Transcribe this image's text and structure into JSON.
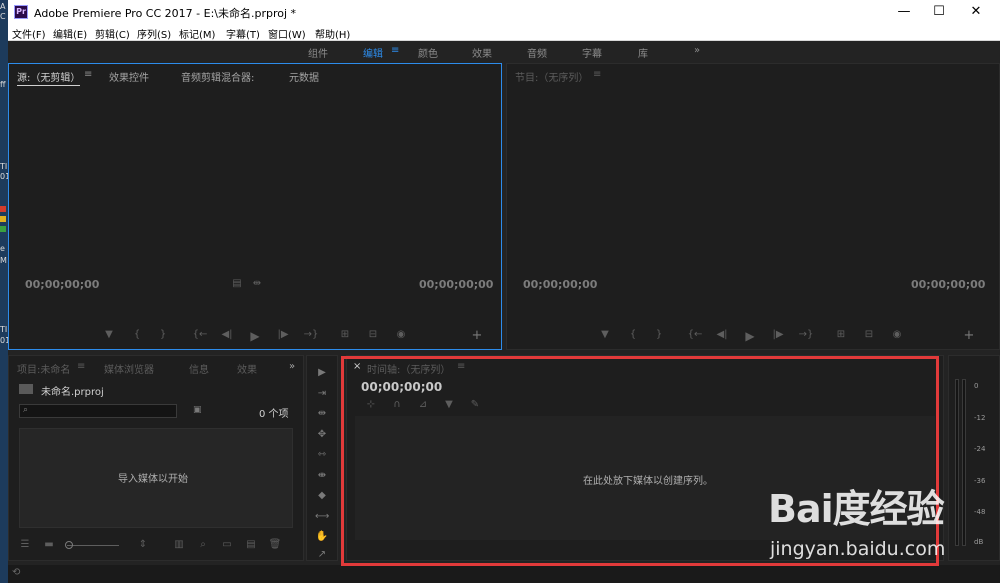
{
  "window": {
    "title": "Adobe Premiere Pro CC 2017 - E:\\未命名.prproj *",
    "app_icon_text": "Pr",
    "minimize_glyph": "—",
    "maximize_glyph": "☐",
    "close_glyph": "✕"
  },
  "desktop": {
    "glyphs": [
      "A",
      "C",
      "ff",
      "TI",
      "01",
      "e",
      "M",
      "TI",
      "01"
    ]
  },
  "menu": {
    "items": [
      "文件(F)",
      "编辑(E)",
      "剪辑(C)",
      "序列(S)",
      "标记(M)",
      "字幕(T)",
      "窗口(W)",
      "帮助(H)"
    ]
  },
  "workspaces": {
    "tabs": [
      "组件",
      "编辑",
      "颜色",
      "效果",
      "音频",
      "字幕",
      "库"
    ],
    "active": "编辑",
    "menu_glyph": "≡",
    "overflow_glyph": "»"
  },
  "source_panel": {
    "tabs": [
      "源:（无剪辑）",
      "效果控件",
      "音频剪辑混合器:",
      "元数据"
    ],
    "menu_glyph": "≡",
    "timecode_left": "00;00;00;00",
    "timecode_right": "00;00;00;00"
  },
  "program_panel": {
    "title": "节目:（无序列）",
    "menu_glyph": "≡",
    "timecode_left": "00;00;00;00",
    "timecode_right": "00;00;00;00"
  },
  "transport_icons": [
    "▼",
    "{",
    "}",
    "{←",
    "◀|",
    "▶",
    "|▶",
    "→}",
    "⊞",
    "⊟",
    "◉",
    "+"
  ],
  "project_panel": {
    "tabs": [
      "项目:未命名",
      "媒体浏览器",
      "信息",
      "效果"
    ],
    "menu_glyph": "≡",
    "overflow_glyph": "»",
    "project_file": "未命名.prproj",
    "search_placeholder": "",
    "item_count": "0 个项",
    "import_hint": "导入媒体以开始"
  },
  "timeline_panel": {
    "close_glyph": "×",
    "title": "时间轴:（无序列）",
    "menu_glyph": "≡",
    "timecode": "00;00;00;00",
    "drop_hint": "在此处放下媒体以创建序列。"
  },
  "tools": [
    "▶",
    "⇥",
    "⇹",
    "✥",
    "⇿",
    "⇼",
    "◆",
    "⟷",
    "✋",
    "↗"
  ],
  "audio_meter": {
    "labels": [
      "0",
      "-12",
      "-24",
      "-36",
      "-48",
      "dB"
    ]
  },
  "watermark": {
    "logo": "Bai度经验",
    "url": "jingyan.baidu.com"
  },
  "colors": {
    "accent": "#2d8ceb",
    "highlight_box": "#e23a3a",
    "panel_bg": "#1e1e1e",
    "window_bg": "#232323"
  }
}
